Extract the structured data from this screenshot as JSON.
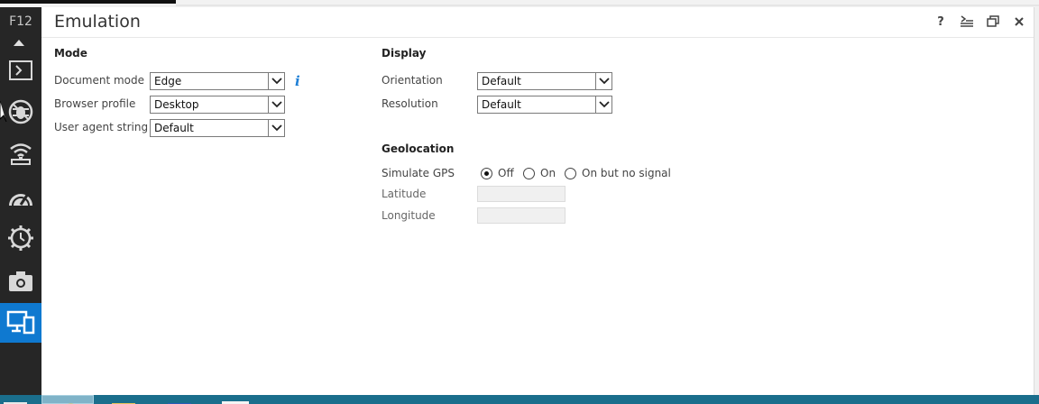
{
  "rail": {
    "title": "F12",
    "tools": [
      {
        "name": "console-icon",
        "active": false
      },
      {
        "name": "debugger-icon",
        "active": false
      },
      {
        "name": "network-icon",
        "active": false
      },
      {
        "name": "performance-icon",
        "active": false
      },
      {
        "name": "memory-icon",
        "active": false
      },
      {
        "name": "screenshot-icon",
        "active": false
      },
      {
        "name": "emulation-icon",
        "active": true
      }
    ]
  },
  "panel": {
    "title": "Emulation",
    "header_buttons": {
      "help": "?"
    }
  },
  "mode": {
    "title": "Mode",
    "document_mode": {
      "label": "Document mode",
      "value": "Edge"
    },
    "browser_profile": {
      "label": "Browser profile",
      "value": "Desktop"
    },
    "user_agent": {
      "label": "User agent string",
      "value": "Default"
    }
  },
  "display": {
    "title": "Display",
    "orientation": {
      "label": "Orientation",
      "value": "Default"
    },
    "resolution": {
      "label": "Resolution",
      "value": "Default"
    }
  },
  "geolocation": {
    "title": "Geolocation",
    "simulate_gps": {
      "label": "Simulate GPS",
      "options": [
        "Off",
        "On",
        "On but no signal"
      ],
      "selected": "Off"
    },
    "latitude": {
      "label": "Latitude",
      "value": ""
    },
    "longitude": {
      "label": "Longitude",
      "value": ""
    }
  },
  "colors": {
    "rail_bg": "#262626",
    "accent": "#0f79d0",
    "taskbar": "#1a6e8c"
  }
}
